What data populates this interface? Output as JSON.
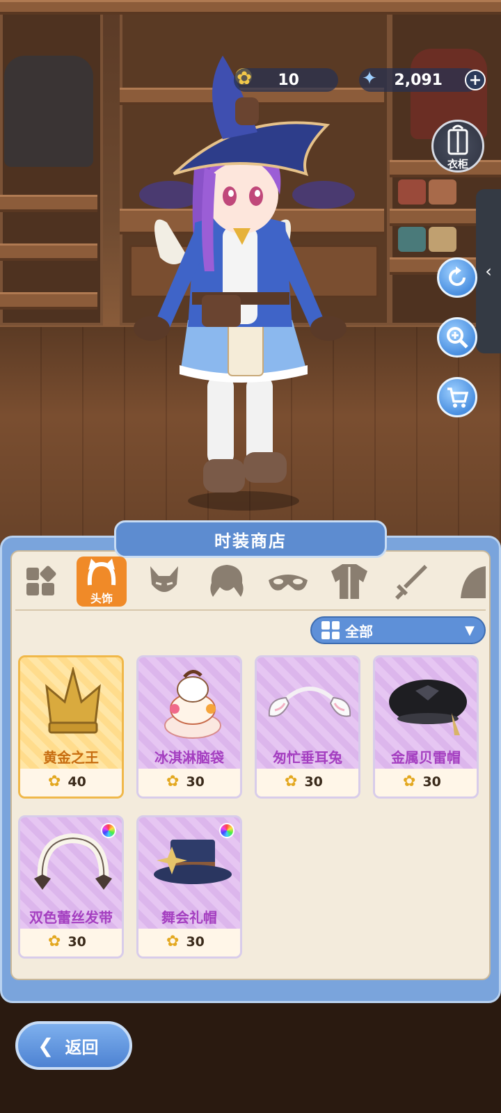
{
  "currency": {
    "star_amount": "10",
    "crystal_amount": "2,091",
    "plus": "+"
  },
  "right_buttons": {
    "wardrobe_label": "衣柜",
    "side_tab_arrow": "‹"
  },
  "shop": {
    "title": "时装商店",
    "active_tab_label": "头饰",
    "filter_label": "全部",
    "filter_arrow": "▼"
  },
  "items": [
    {
      "name": "黄金之王",
      "price": "40",
      "rarity": "gold",
      "icon": "gold-crown-icon"
    },
    {
      "name": "冰淇淋脑袋",
      "price": "30",
      "rarity": "purple",
      "icon": "ice-cream-icon"
    },
    {
      "name": "匆忙垂耳兔",
      "price": "30",
      "rarity": "purple",
      "icon": "bunny-ears-icon"
    },
    {
      "name": "金属贝雷帽",
      "price": "30",
      "rarity": "purple",
      "icon": "beret-icon"
    },
    {
      "name": "双色蕾丝发带",
      "price": "30",
      "rarity": "purple",
      "icon": "lace-headband-icon"
    },
    {
      "name": "舞会礼帽",
      "price": "30",
      "rarity": "purple",
      "icon": "top-hat-icon"
    }
  ],
  "back": {
    "label": "返回"
  },
  "colors": {
    "accent_blue": "#5e90d8",
    "active_tab_orange": "#f08a28",
    "gold_name": "#c76d10",
    "purple_name": "#a43ec0"
  }
}
